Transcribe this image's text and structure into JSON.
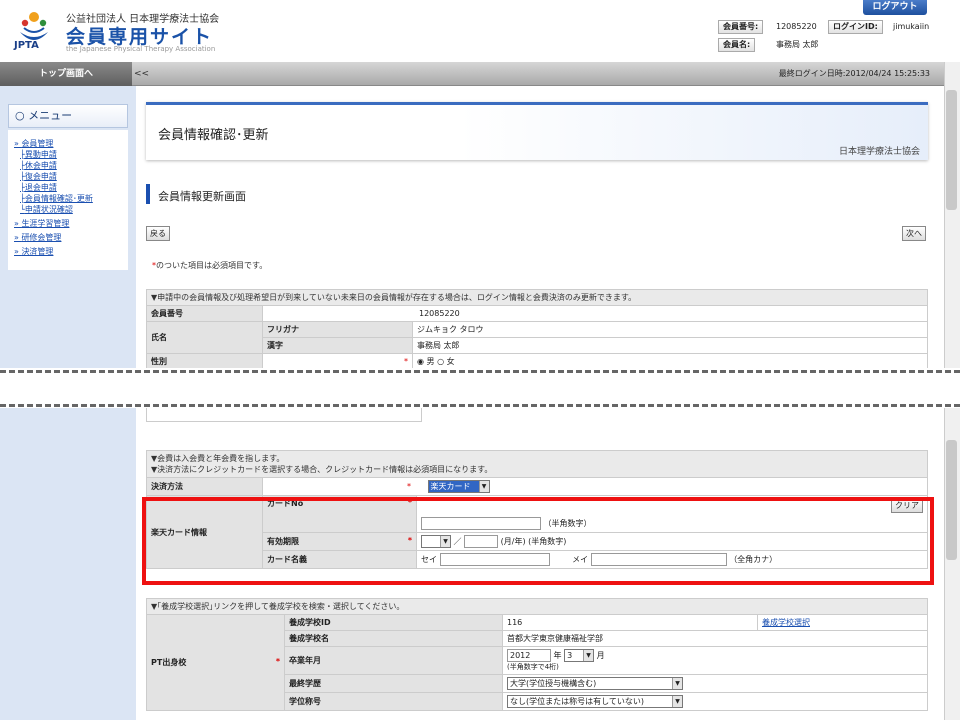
{
  "header": {
    "org_name": "公益社団法人 日本理学療法士協会",
    "site_title": "会員専用サイト",
    "site_sub": "the Japanese Physical Therapy Association",
    "logo_text": "JPTA",
    "logout": "ログアウト",
    "member_no_label": "会員番号:",
    "member_no": "12085220",
    "login_id_label": "ログインID:",
    "login_id": "jimukaiin",
    "member_name_label": "会員名:",
    "member_name": "事務局 太郎"
  },
  "navbar": {
    "top_button": "トップ画面へ",
    "collapse": "<<",
    "last_login": "最終ログイン日時:2012/04/24 15:25:33"
  },
  "sidebar": {
    "menu_title": "○ メニュー",
    "items": [
      {
        "label": "会員管理",
        "level": 0
      },
      {
        "label": "異動申請",
        "level": 1
      },
      {
        "label": "休会申請",
        "level": 1
      },
      {
        "label": "復会申請",
        "level": 1
      },
      {
        "label": "退会申請",
        "level": 1
      },
      {
        "label": "会員情報確認･更新",
        "level": 1
      },
      {
        "label": "申請状況確認",
        "level": 1
      },
      {
        "label": "生涯学習管理",
        "level": 0
      },
      {
        "label": "研修会管理",
        "level": 0
      },
      {
        "label": "決済管理",
        "level": 0
      }
    ]
  },
  "main": {
    "page_title": "会員情報確認･更新",
    "page_org": "日本理学療法士協会",
    "section_title": "会員情報更新画面",
    "back_button": "戻る",
    "next_button": "次へ",
    "required_mark": "*",
    "required_note": "のついた項目は必須項目です。"
  },
  "member_table": {
    "caption": "▼申請中の会員情報及び処理希望日が到来していない未来日の会員情報が存在する場合は、ログイン情報と会費決済のみ更新できます。",
    "member_no_label": "会員番号",
    "member_no": "12085220",
    "name_label": "氏名",
    "furigana_label": "フリガナ",
    "furigana": "ジムキョク タロウ",
    "kanji_label": "漢字",
    "kanji": "事務局 太郎",
    "gender_label": "性別",
    "male": "男",
    "female": "女"
  },
  "payment_table": {
    "caption1": "▼会費は入会費と年会費を指します。",
    "caption2": "▼決済方法にクレジットカードを選択する場合、クレジットカード情報は必須項目になります。",
    "method_label": "決済方法",
    "method_value": "楽天カード",
    "card_info_label": "楽天カード情報",
    "clear_button": "クリア",
    "card_no_label": "カードNo",
    "card_no_hint": "（半角数字）",
    "expiry_label": "有効期限",
    "expiry_sep": "／",
    "expiry_hint": "(月/年) (半角数字)",
    "card_name_label": "カード名義",
    "sei": "セイ",
    "mei": "メイ",
    "name_hint": "（全角カナ）"
  },
  "school_table": {
    "caption": "▼｢養成学校選択｣リンクを押して養成学校を検索・選択してください。",
    "pt_school_label": "PT出身校",
    "school_id_label": "養成学校ID",
    "school_id": "116",
    "select_link": "養成学校選択",
    "school_name_label": "養成学校名",
    "school_name": "首都大学東京健康福祉学部",
    "grad_label": "卒業年月",
    "grad_year": "2012",
    "year_unit": "年",
    "grad_month": "3",
    "month_unit": "月",
    "grad_hint": "(半角数字で4桁)",
    "edu_label": "最終学歴",
    "edu_value": "大学(学位授与機構含む)",
    "degree_label": "学位称号",
    "degree_value": "なし(学位または称号は有していない)"
  }
}
